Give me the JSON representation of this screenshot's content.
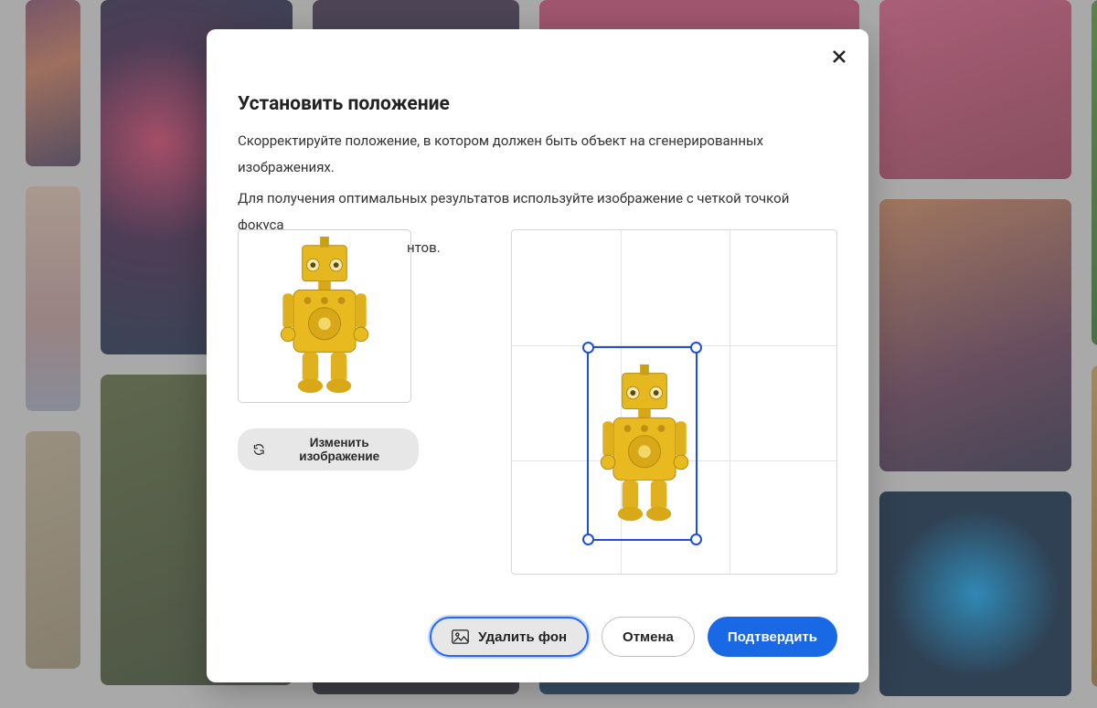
{
  "modal": {
    "title": "Установить положение",
    "desc_line1": "Скорректируйте положение, в котором должен быть объект на сгенерированных изображениях.",
    "desc_line2": "Для получения оптимальных результатов используйте изображение с четкой точкой фокуса",
    "desc_line3_fragment": "нтов.",
    "change_image_label": "Изменить изображение",
    "remove_bg_label": "Удалить фон",
    "cancel_label": "Отмена",
    "confirm_label": "Подтвердить"
  }
}
